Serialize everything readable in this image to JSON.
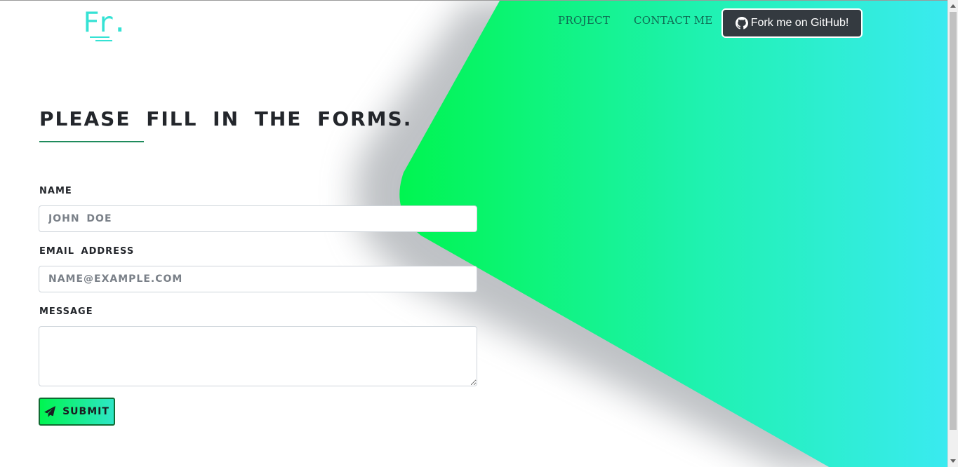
{
  "logo": {
    "text": "Fr."
  },
  "nav": {
    "items": [
      {
        "label": "PROJECT"
      },
      {
        "label": "CONTACT ME"
      }
    ],
    "github_label": "Fork me on GitHub!"
  },
  "form": {
    "heading": "PLEASE FILL IN THE FORMS.",
    "name_label": "NAME",
    "name_placeholder": "JOHN DOE",
    "email_label": "EMAIL ADDRESS",
    "email_placeholder": "NAME@EXAMPLE.COM",
    "message_label": "MESSAGE",
    "message_value": "",
    "submit_label": "SUBMIT"
  },
  "colors": {
    "accent_green": "#00f550",
    "accent_cyan": "#3aeaf0",
    "logo": "#35e2d4",
    "nav_text": "#0f6b53",
    "github_bg": "#343a40",
    "heading_text": "#23262b",
    "underline": "#1f8b5c"
  },
  "icons": {
    "github": "github-icon",
    "submit": "paper-plane-icon"
  }
}
